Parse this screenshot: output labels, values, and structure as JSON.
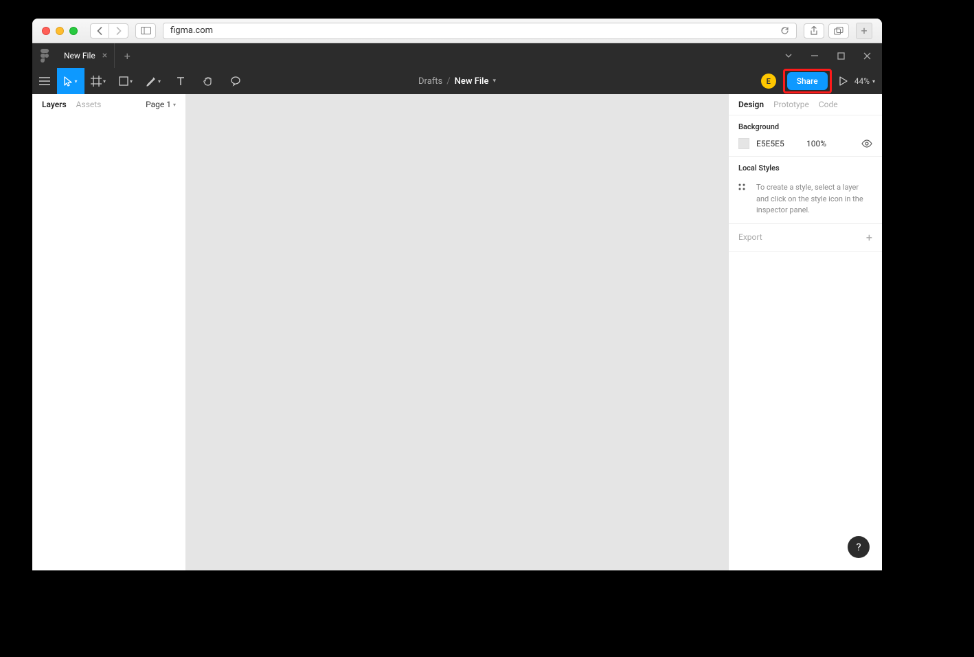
{
  "browser": {
    "url": "figma.com"
  },
  "app": {
    "tab_name": "New File",
    "breadcrumb_drafts": "Drafts",
    "breadcrumb_slash": "/",
    "breadcrumb_file": "New File",
    "avatar_letter": "E",
    "share_label": "Share",
    "zoom": "44%"
  },
  "left_panel": {
    "tabs": {
      "layers": "Layers",
      "assets": "Assets"
    },
    "page_label": "Page 1"
  },
  "right_panel": {
    "tabs": {
      "design": "Design",
      "prototype": "Prototype",
      "code": "Code"
    },
    "background": {
      "title": "Background",
      "hex": "E5E5E5",
      "opacity": "100%"
    },
    "local_styles": {
      "title": "Local Styles",
      "hint": "To create a style, select a layer and click on the style icon in the inspector panel."
    },
    "export_label": "Export"
  },
  "help_label": "?"
}
